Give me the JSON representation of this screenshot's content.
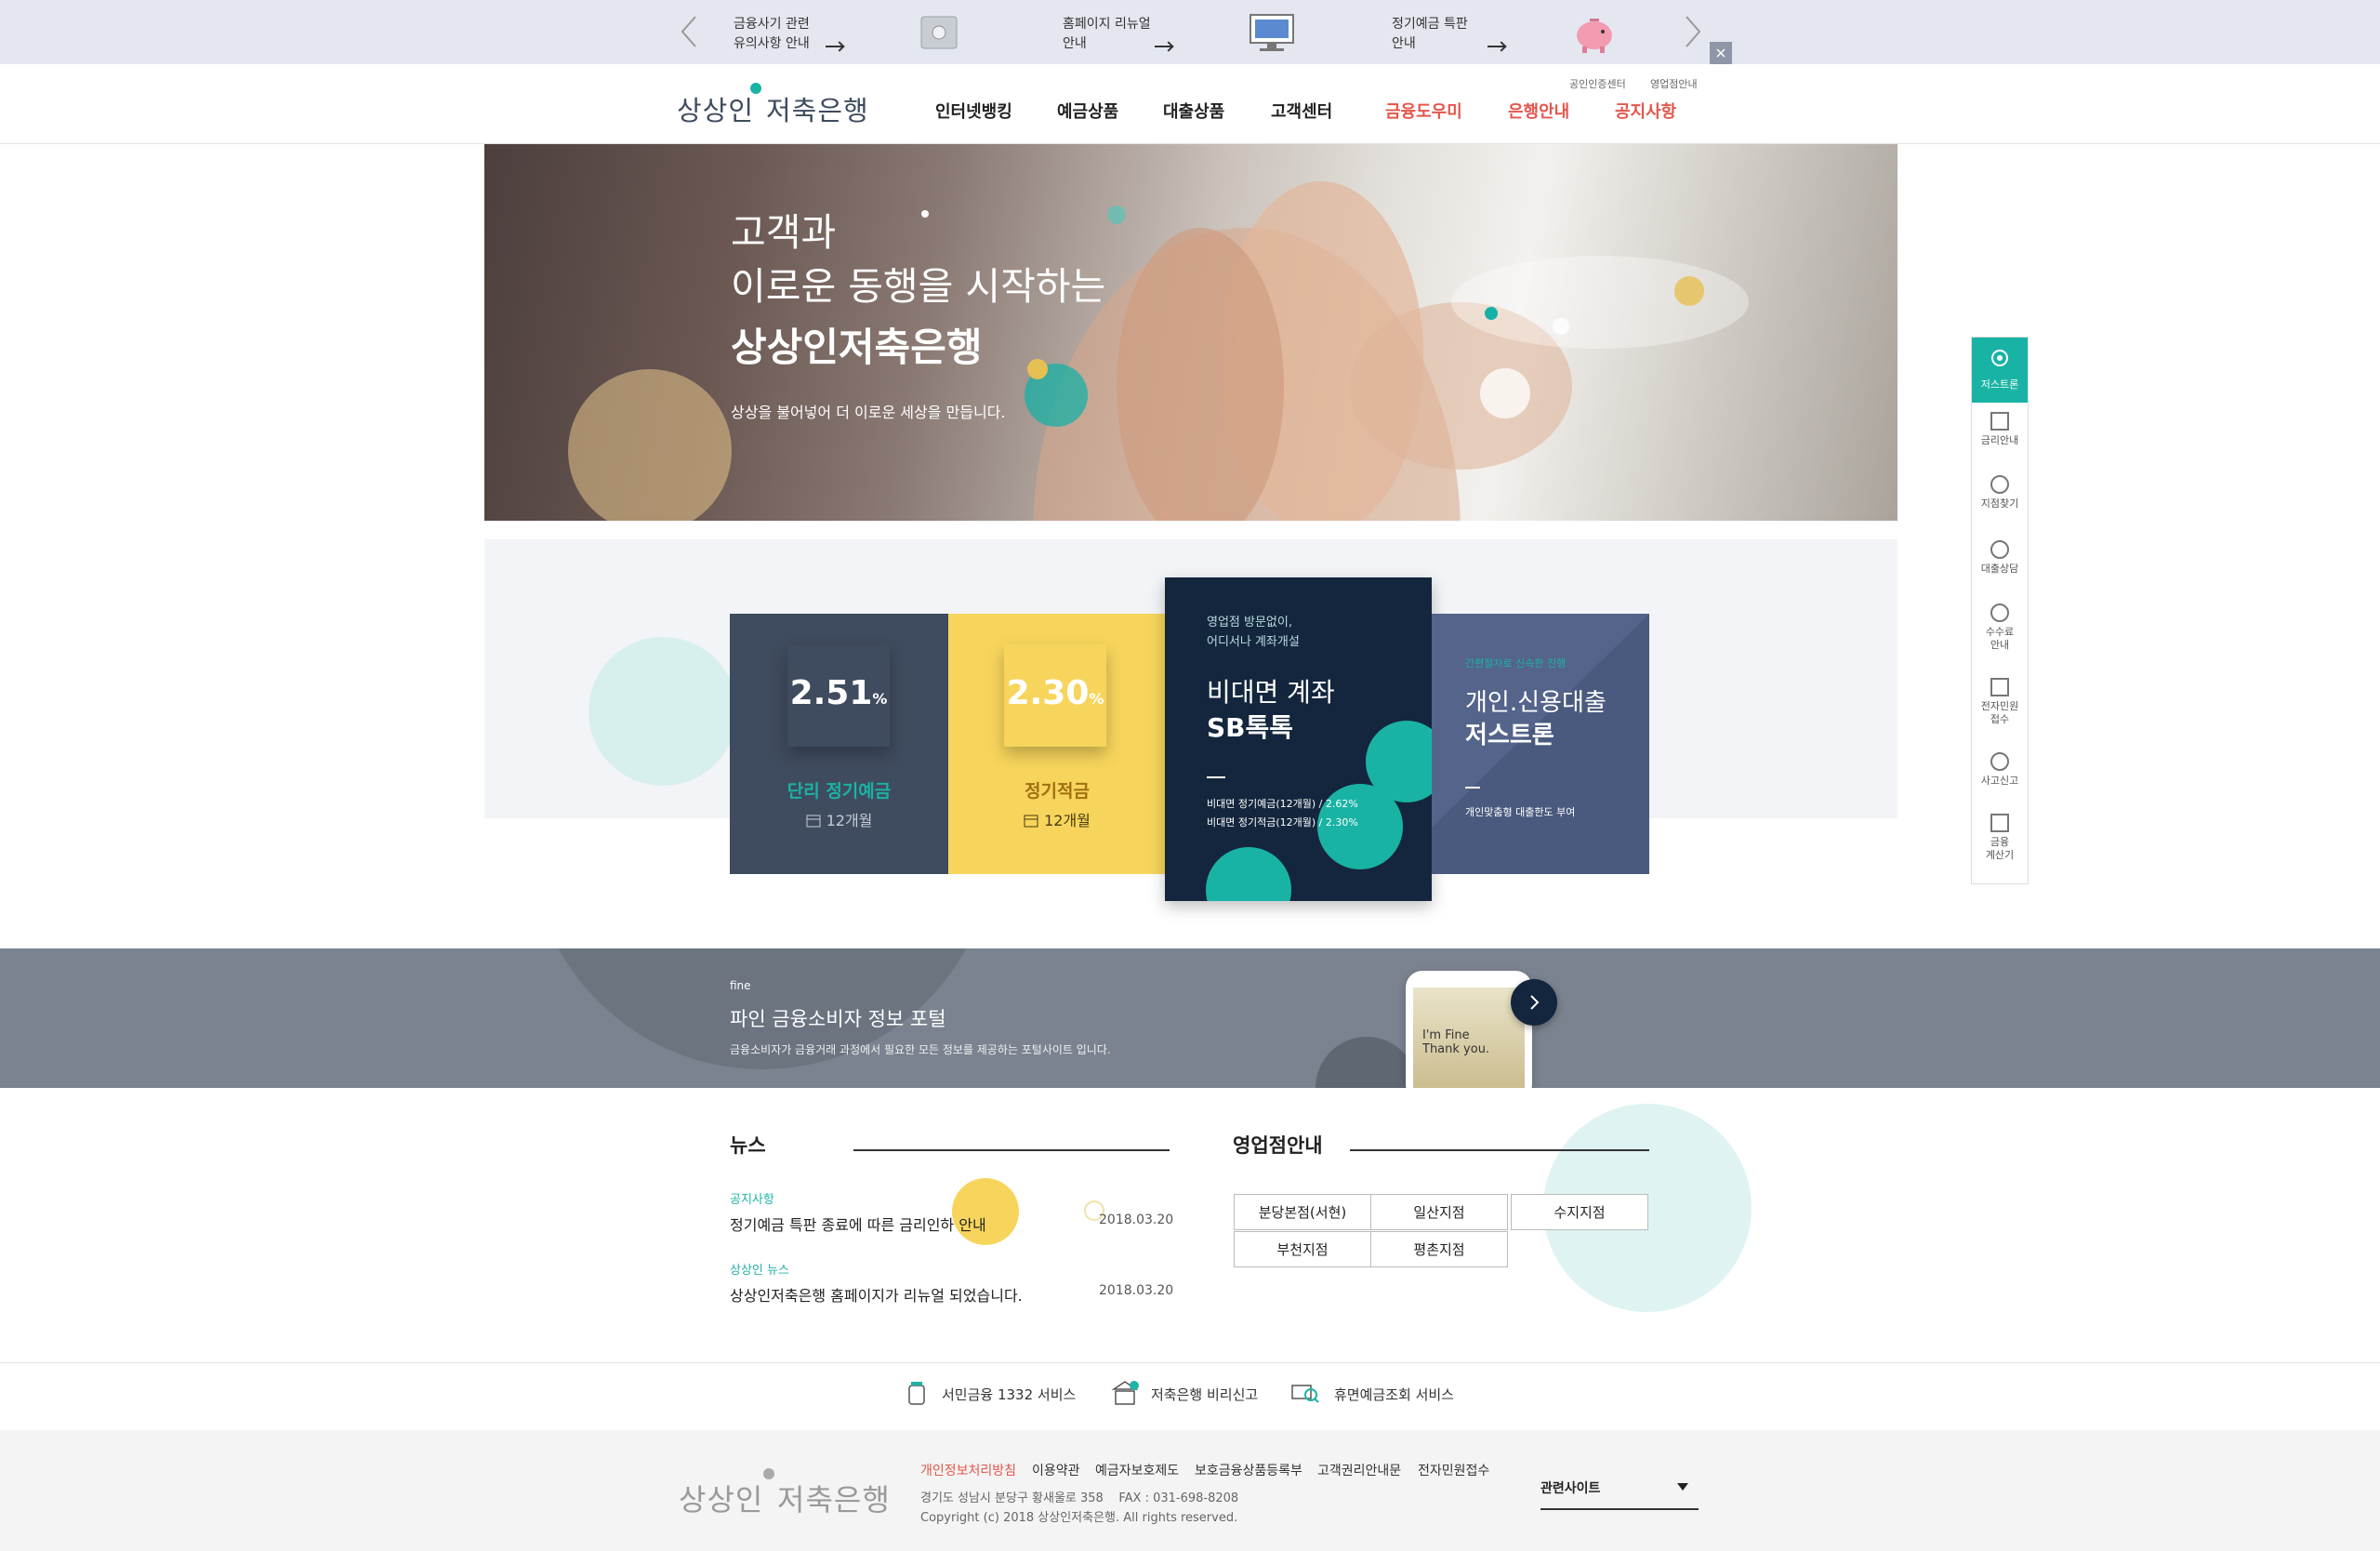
{
  "notice": {
    "items": [
      {
        "line1": "금융사기 관련",
        "line2": "유의사항 안내"
      },
      {
        "line1": "홈페이지 리뉴얼",
        "line2": "안내"
      },
      {
        "line1": "정기예금 특판",
        "line2": "안내"
      }
    ]
  },
  "header": {
    "logo_prefix": "상상인",
    "logo_suffix": "저축은행",
    "util_links": [
      "공인인증센터",
      "영업점안내"
    ],
    "nav": [
      "인터넷뱅킹",
      "예금상품",
      "대출상품",
      "고객센터",
      "금융도우미",
      "은행안내",
      "공지사항"
    ]
  },
  "hero": {
    "line1": "고객과",
    "line2": "이로운 동행을 시작하는",
    "line3": "상상인저축은행",
    "sub": "상상을 불어넣어 더 이로운 세상을 만듭니다."
  },
  "products": {
    "card1": {
      "rate": "2.51",
      "unit": "%",
      "name": "단리 정기예금",
      "term": "12개월"
    },
    "card2": {
      "rate": "2.30",
      "unit": "%",
      "name": "정기적금",
      "term": "12개월"
    },
    "card3": {
      "eyebrow1": "영업점 방문없이,",
      "eyebrow2": "어디서나 계좌개설",
      "title1": "비대면 계좌",
      "title2": "SB톡톡",
      "detail1": "비대면 정기예금(12개월) / 2.62%",
      "detail2": "비대면 정기적금(12개월) / 2.30%"
    },
    "card4": {
      "eyebrow": "간편절차로 신속한 진행",
      "title1": "개인.신용대출",
      "title2": "저스트론",
      "detail": "개인맞춤형 대출한도 부여"
    }
  },
  "side_menu": [
    "저스트론",
    "금리안내",
    "지점찾기",
    "대출상담",
    "수수료\n안내",
    "전자민원\n접수",
    "사고신고",
    "금융\n계산기"
  ],
  "fine": {
    "tag": "fine",
    "title": "파인 금융소비자 정보 포털",
    "desc": "금융소비자가 금융거래 과정에서 필요한 모든 정보를 제공하는 포털사이트 입니다.",
    "phone_text1": "I'm Fine",
    "phone_text2": "Thank you."
  },
  "news": {
    "title": "뉴스",
    "items": [
      {
        "category": "공지사항",
        "title": "정기예금 특판 종료에 따른 금리인하 안내",
        "date": "2018.03.20"
      },
      {
        "category": "상상인 뉴스",
        "title": "상상인저축은행 홈페이지가 리뉴얼 되었습니다.",
        "date": "2018.03.20"
      }
    ]
  },
  "branches": {
    "title": "영업점안내",
    "items": [
      "분당본점(서현)",
      "일산지점",
      "수지지점",
      "부천지점",
      "평촌지점"
    ]
  },
  "services": [
    "서민금융 1332 서비스",
    "저축은행 비리신고",
    "휴면예금조회 서비스"
  ],
  "footer": {
    "links": [
      "개인정보처리방침",
      "이용약관",
      "예금자보호제도",
      "보호금융상품등록부",
      "고객권리안내문",
      "전자민원접수"
    ],
    "address": "경기도 성남시 분당구 황새울로 358    FAX : 031-698-8208",
    "copyright": "Copyright (c) 2018 상상인저축은행. All rights reserved.",
    "related_label": "관련사이트"
  },
  "colors": {
    "teal": "#19b3a5",
    "yellow": "#f7d55c",
    "navy": "#13263d",
    "slate": "#3f4b5e",
    "red": "#e4564b"
  }
}
